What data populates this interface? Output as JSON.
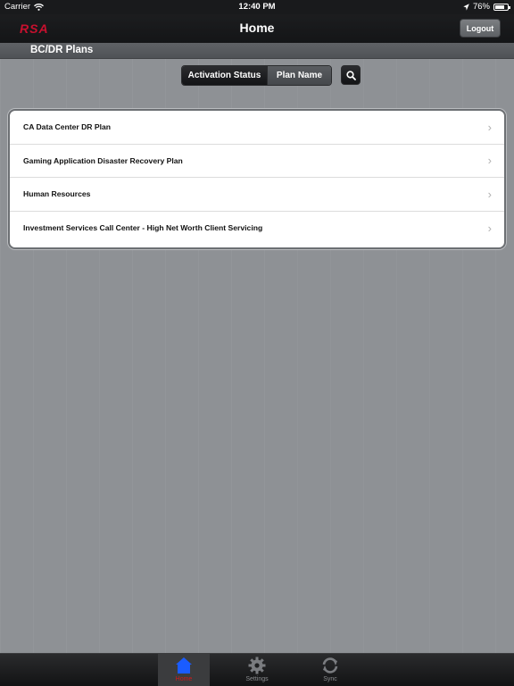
{
  "statusbar": {
    "carrier": "Carrier",
    "time": "12:40 PM",
    "battery_percent": "76%",
    "battery_level": 0.76
  },
  "navbar": {
    "logo": "RSA",
    "title": "Home",
    "logout_label": "Logout"
  },
  "section": {
    "title": "BC/DR Plans"
  },
  "sort_control": {
    "options": [
      "Activation Status",
      "Plan Name"
    ],
    "selected": "Activation Status"
  },
  "plans": [
    {
      "name": "CA Data Center DR Plan"
    },
    {
      "name": "Gaming Application Disaster Recovery Plan"
    },
    {
      "name": "Human Resources"
    },
    {
      "name": "Investment Services Call Center - High Net Worth Client Servicing"
    }
  ],
  "tabbar": {
    "tabs": [
      {
        "label": "Home",
        "icon": "home-icon",
        "selected": true
      },
      {
        "label": "Settings",
        "icon": "gear-icon",
        "selected": false
      },
      {
        "label": "Sync",
        "icon": "sync-icon",
        "selected": false
      }
    ]
  },
  "colors": {
    "brand_red": "#c8102e",
    "selected_tab_icon": "#1a5cff",
    "background": "#8e9195"
  }
}
